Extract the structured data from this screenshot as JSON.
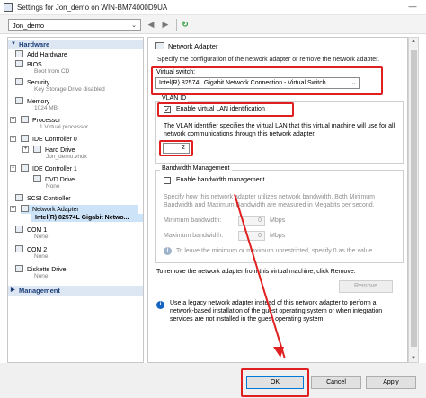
{
  "window": {
    "title": "Settings for Jon_demo on WIN-BM74000D9UA"
  },
  "toolbar": {
    "vm_name": "Jon_demo",
    "chevron": "⌄",
    "back": "◀",
    "forward": "▶",
    "refresh": "↻"
  },
  "tree": {
    "hardware_header": "Hardware",
    "management_header": "Management",
    "items": [
      {
        "label": "Add Hardware"
      },
      {
        "label": "BIOS",
        "sub": "Boot from CD"
      },
      {
        "label": "Security",
        "sub": "Key Storage Drive disabled"
      },
      {
        "label": "Memory",
        "sub": "1024 MB"
      },
      {
        "label": "Processor",
        "sub": "1 Virtual processor"
      },
      {
        "label": "IDE Controller 0"
      },
      {
        "label": "Hard Drive",
        "sub": "Jon_demo.vhdx"
      },
      {
        "label": "IDE Controller 1"
      },
      {
        "label": "DVD Drive",
        "sub": "None"
      },
      {
        "label": "SCSI Controller"
      },
      {
        "label": "Network Adapter",
        "sub": "Intel(R) 82574L Gigabit Netwo..."
      },
      {
        "label": "COM 1",
        "sub": "None"
      },
      {
        "label": "COM 2",
        "sub": "None"
      },
      {
        "label": "Diskette Drive",
        "sub": "None"
      }
    ],
    "expander_plus": "+",
    "expander_minus": "−"
  },
  "panel": {
    "heading": "Network Adapter",
    "description": "Specify the configuration of the network adapter or remove the network adapter.",
    "virtual_switch_label": "Virtual switch:",
    "virtual_switch_value": "Intel(R) 82574L Gigabit Network Connection - Virtual Switch",
    "vlan_group": "VLAN ID",
    "vlan_checkbox_label": "Enable virtual LAN identification",
    "vlan_checked_mark": "✓",
    "vlan_description_1": "The VLAN identifier specifies the virtual LAN that this virtual machine will use for all",
    "vlan_description_2": "network communications through this network adapter.",
    "vlan_id_value": "2",
    "bandwidth_group": "Bandwidth Management",
    "bandwidth_checkbox_label": "Enable bandwidth management",
    "bandwidth_desc_1": "Specify how this network adapter utilizes network bandwidth. Both Minimum",
    "bandwidth_desc_2": "Bandwidth and Maximum Bandwidth are measured in Megabits per second.",
    "min_bandwidth_label": "Minimum bandwidth:",
    "min_bandwidth_value": "0",
    "max_bandwidth_label": "Maximum bandwidth:",
    "max_bandwidth_value": "0",
    "unit": "Mbps",
    "unrestricted_note": "To leave the minimum or maximum unrestricted, specify 0 as the value.",
    "remove_note": "To remove the network adapter from this virtual machine, click Remove.",
    "remove_button": "Remove",
    "legacy_note_1": "Use a legacy network adapter instead of this network adapter to perform a",
    "legacy_note_2": "network-based installation of the guest operating system or when integration",
    "legacy_note_3": "services are not installed in the guest operating system.",
    "info_glyph": "i"
  },
  "footer": {
    "ok": "OK",
    "cancel": "Cancel",
    "apply": "Apply"
  },
  "colors": {
    "highlight": "#e02020",
    "selection": "#cde3f7",
    "header": "#dde7f3"
  }
}
